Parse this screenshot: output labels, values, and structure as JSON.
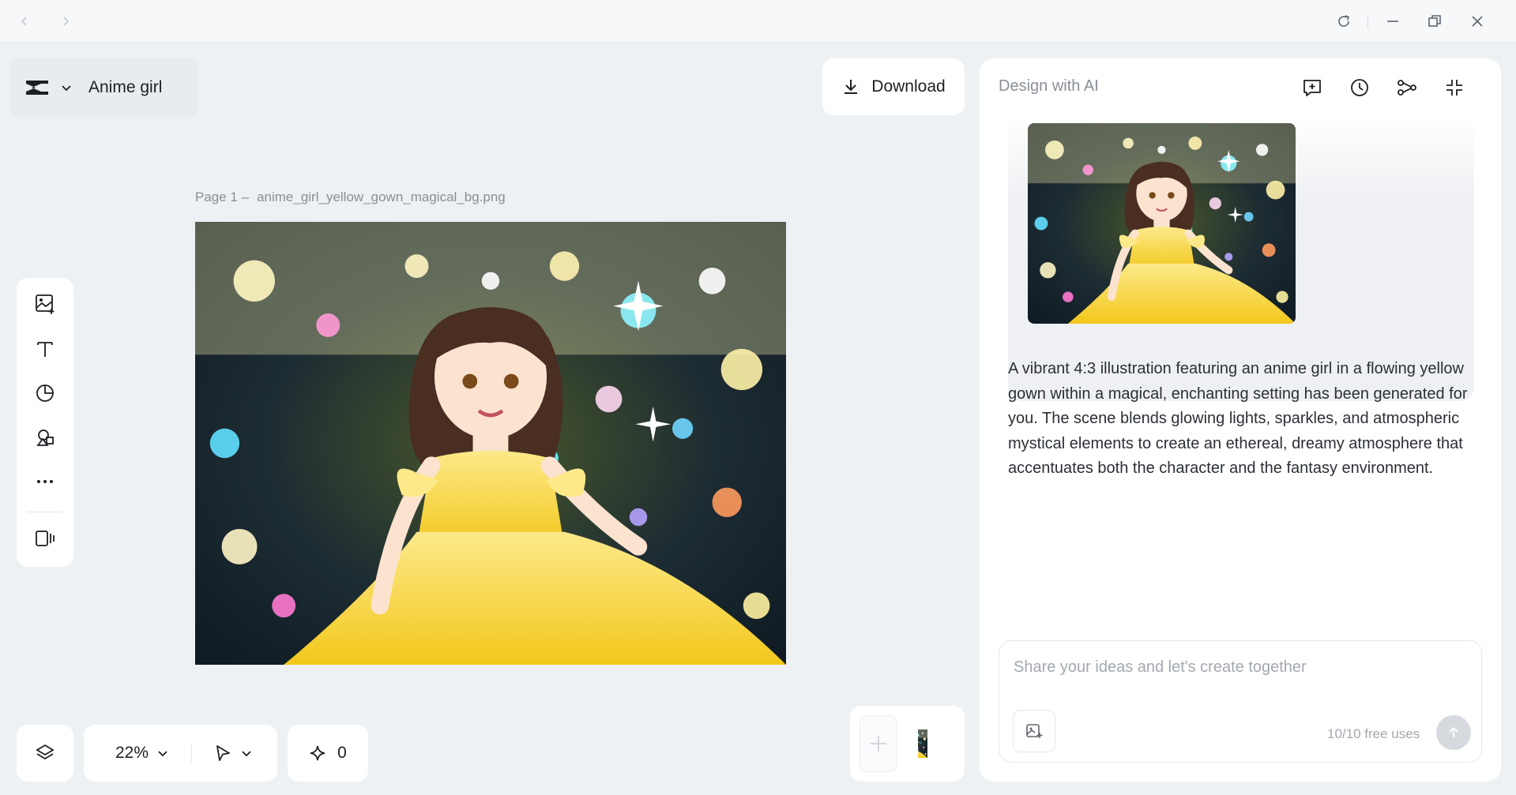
{
  "app": {
    "project_name": "Anime girl"
  },
  "header": {
    "download_label": "Download"
  },
  "canvas": {
    "page_label": "Page 1 –",
    "file_name": "anime_girl_yellow_gown_magical_bg.png"
  },
  "toolbar": {
    "tools": [
      "add-image-icon",
      "text-icon",
      "sticker-icon",
      "shapes-icon",
      "more-icon",
      "panel-icon"
    ]
  },
  "bottom": {
    "zoom": "22%",
    "credits": "0"
  },
  "panel": {
    "title": "Design with AI",
    "description": "A vibrant 4:3 illustration featuring an anime girl in a flowing yellow gown within a magical, enchanting setting has been generated for you. The scene blends glowing lights, sparkles, and atmospheric mystical elements to create an ethereal, dreamy atmosphere that accentuates both the character and the fantasy environment.",
    "composer_placeholder": "Share your ideas and let's create together",
    "free_uses": "10/10 free uses"
  },
  "colors": {
    "accent_yellow": "#f5d232",
    "panel_bg": "#ffffff",
    "app_bg": "#eef1f4"
  }
}
